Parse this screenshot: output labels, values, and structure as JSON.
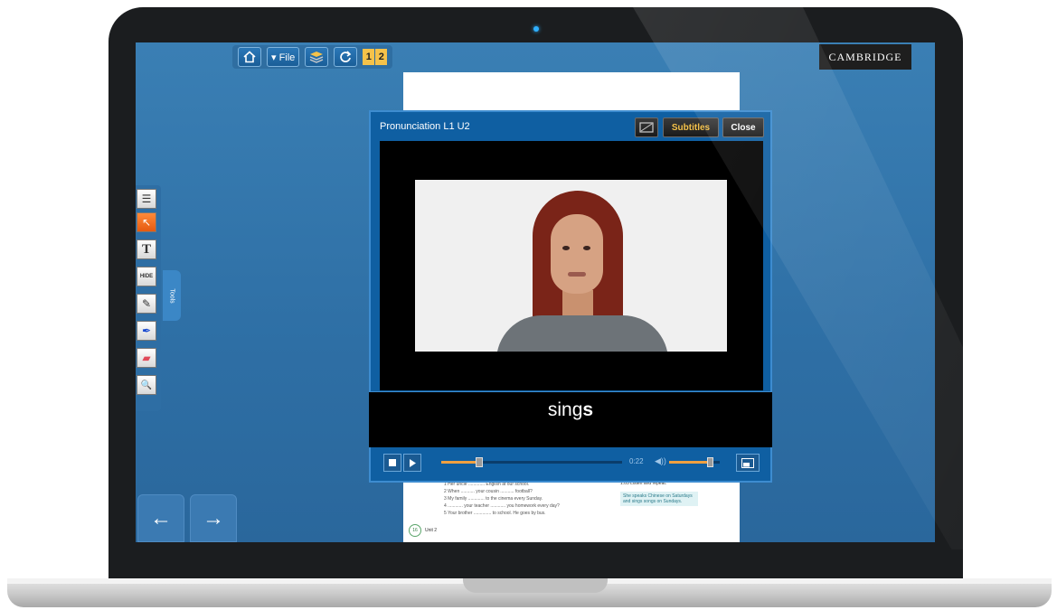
{
  "toolbar": {
    "home_icon": "home-icon",
    "file_label": "▾ File",
    "book_icon": "book-icon",
    "refresh_icon": "refresh-icon",
    "page_left": "1",
    "page_right": "2"
  },
  "brand": "CAMBRIDGE",
  "sidebar": {
    "tools_tab_label": "Tools",
    "tools": [
      {
        "icon": "notes-icon",
        "glyph": "☰"
      },
      {
        "icon": "pointer-icon",
        "glyph": "↖"
      },
      {
        "icon": "text-icon",
        "glyph": "T"
      },
      {
        "icon": "hide-icon",
        "glyph": "HIDE"
      },
      {
        "icon": "marker-icon",
        "glyph": "✎"
      },
      {
        "icon": "pen-icon",
        "glyph": "✒"
      },
      {
        "icon": "eraser-icon",
        "glyph": "▰"
      },
      {
        "icon": "zoom-icon",
        "glyph": "🔍"
      }
    ]
  },
  "video_window": {
    "title": "Pronunciation L1 U2",
    "subtitles_label": "Subtitles",
    "close_label": "Close",
    "subtitle_text_plain": "sing",
    "subtitle_text_bold": "s",
    "time": "0:22",
    "progress": 0.21,
    "volume": 0.8
  },
  "page": {
    "exercise_lines": [
      "1  Her uncle ............. English at our school.",
      "2  When ........... your cousin ........... football?",
      "3  My family ............. to the cinema every Sunday.",
      "4  ............ your teacher ............ you homework every day?",
      "5  Your brother .............. to school. He goes by bus."
    ],
    "listen_label": "1.05  Listen and repeat.",
    "note_text": "She speaks Chinese on Saturdays and sings songs on Sundays.",
    "page_number": "16",
    "unit_label": "Unit 2"
  },
  "nav": {
    "prev": "←",
    "next": "→"
  }
}
